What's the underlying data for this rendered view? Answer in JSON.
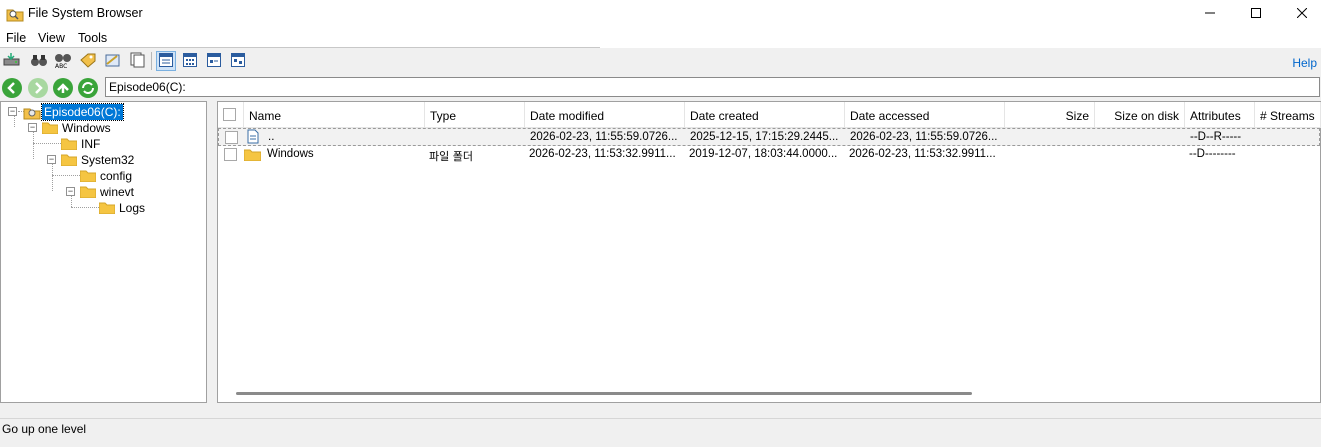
{
  "window": {
    "title": "File System Browser",
    "controls": [
      "minimize-icon",
      "maximize-icon",
      "close-icon"
    ]
  },
  "menu": {
    "file": "File",
    "view": "View",
    "tools": "Tools"
  },
  "toolbar": {
    "help": "Help",
    "buttons": [
      "drive-icon",
      "binoculars-icon",
      "search-text-icon",
      "tag-icon",
      "properties-icon",
      "copy-icon",
      "details-view-icon",
      "icons-view-icon",
      "list-view-icon",
      "thumbnails-view-icon"
    ]
  },
  "address": {
    "path": "Episode06(C):",
    "nav": [
      "back-icon",
      "forward-icon",
      "up-icon",
      "refresh-icon"
    ]
  },
  "tree": {
    "root": "Episode06(C):",
    "windows": "Windows",
    "inf": "INF",
    "system32": "System32",
    "config": "config",
    "winevt": "winevt",
    "logs": "Logs"
  },
  "list": {
    "columns": {
      "name": "Name",
      "type": "Type",
      "date_modified": "Date modified",
      "date_created": "Date created",
      "date_accessed": "Date accessed",
      "size": "Size",
      "size_on_disk": "Size on disk",
      "attributes": "Attributes",
      "streams": "# Streams"
    },
    "rows": [
      {
        "name": "..",
        "type": "",
        "date_modified": "2026-02-23, 11:55:59.0726...",
        "date_created": "2025-12-15, 17:15:29.2445...",
        "date_accessed": "2026-02-23, 11:55:59.0726...",
        "attributes": "--D--R-----",
        "icon": "document-icon"
      },
      {
        "name": "Windows",
        "type": "파일 폴더",
        "date_modified": "2026-02-23, 11:53:32.9911...",
        "date_created": "2019-12-07, 18:03:44.0000...",
        "date_accessed": "2026-02-23, 11:53:32.9911...",
        "attributes": "--D--------",
        "icon": "folder-icon"
      }
    ]
  },
  "status": {
    "text": "Go up one level"
  },
  "colors": {
    "selection": "#0078d7",
    "folder": "#f5c542",
    "nav_green": "#3aa43a"
  }
}
